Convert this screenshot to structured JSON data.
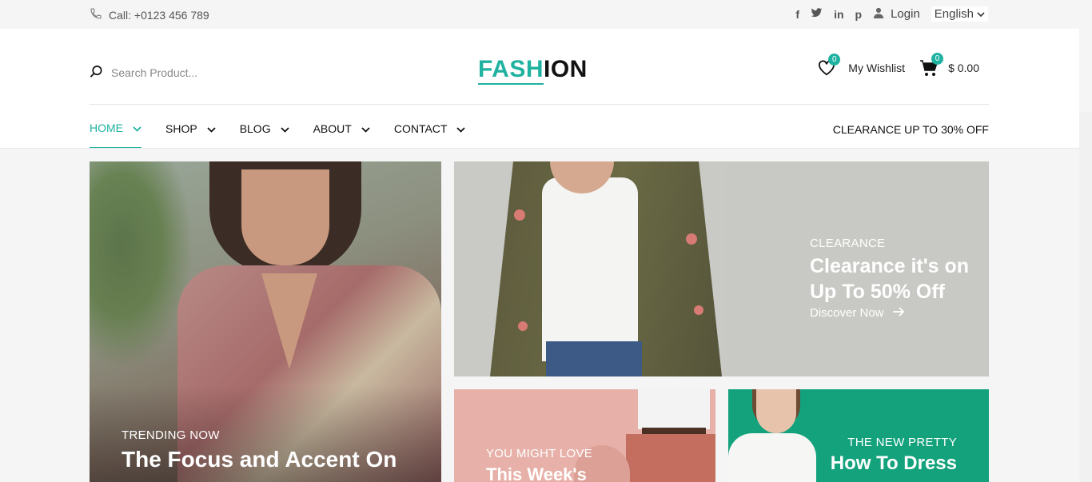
{
  "topbar": {
    "phone": "Call: +0123 456 789",
    "login": "Login",
    "language": "English",
    "social": [
      "f",
      "t",
      "in",
      "p"
    ]
  },
  "header": {
    "search_placeholder": "Search Product...",
    "logo_a": "FASH",
    "logo_b": "ION",
    "wishlist_label": "My Wishlist",
    "wishlist_count": "0",
    "cart_count": "0",
    "cart_total": "$ 0.00"
  },
  "nav": {
    "items": [
      {
        "label": "HOME"
      },
      {
        "label": "SHOP"
      },
      {
        "label": "BLOG"
      },
      {
        "label": "ABOUT"
      },
      {
        "label": "CONTACT"
      }
    ],
    "promo": "CLEARANCE UP TO 30% OFF"
  },
  "banners": {
    "b1": {
      "sub": "TRENDING NOW",
      "title": "The Focus and Accent On"
    },
    "b2": {
      "sub": "CLEARANCE",
      "title1": "Clearance it's on",
      "title2": "Up To 50% Off",
      "cta": "Discover Now"
    },
    "b3": {
      "sub": "YOU MIGHT LOVE",
      "title": "This Week's"
    },
    "b4": {
      "sub": "THE NEW PRETTY",
      "title": "How To Dress"
    }
  },
  "colors": {
    "accent": "#20b2a0",
    "green_banner": "#13a27c",
    "pink_banner": "#e7b1a9"
  }
}
